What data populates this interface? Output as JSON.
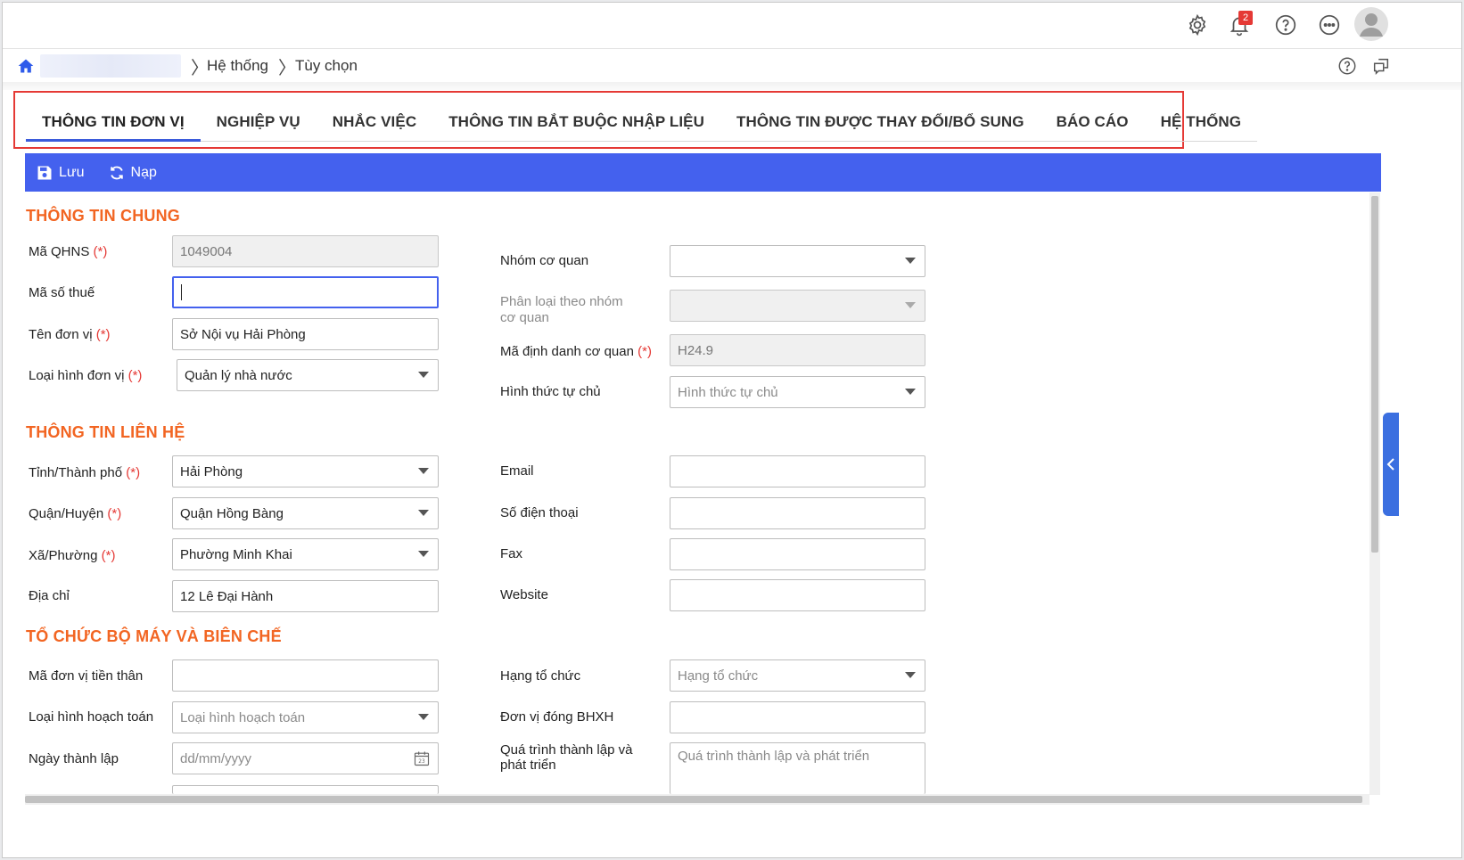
{
  "topbar": {
    "notification_count": "2",
    "icons": [
      "gear-icon",
      "bell-icon",
      "help-icon",
      "more-icon",
      "avatar"
    ]
  },
  "breadcrumb": {
    "items": [
      "Hệ thống",
      "Tùy chọn"
    ]
  },
  "tabs": [
    {
      "label": "THÔNG TIN ĐƠN VỊ",
      "active": true
    },
    {
      "label": "NGHIỆP VỤ"
    },
    {
      "label": "NHẮC VIỆC"
    },
    {
      "label": "THÔNG TIN BẮT BUỘC NHẬP LIỆU"
    },
    {
      "label": "THÔNG TIN ĐƯỢC THAY ĐỔI/BỔ SUNG"
    },
    {
      "label": "BÁO CÁO"
    },
    {
      "label": "HỆ THỐNG"
    }
  ],
  "toolbar": {
    "save_label": "Lưu",
    "reload_label": "Nạp"
  },
  "required_mark": "(*)",
  "sections": {
    "general": {
      "title": "THÔNG TIN CHUNG",
      "ma_qhns": {
        "label": "Mã QHNS",
        "value": "1049004"
      },
      "ma_so_thue": {
        "label": "Mã số thuế",
        "value": ""
      },
      "ten_don_vi": {
        "label": "Tên đơn vị",
        "value": "Sở Nội vụ Hải Phòng"
      },
      "loai_hinh": {
        "label": "Loại hình đơn vị",
        "value": "Quản lý nhà nước"
      },
      "nhom_co_quan": {
        "label": "Nhóm cơ quan",
        "value": ""
      },
      "phan_loai": {
        "label_line1": "Phân loại theo nhóm",
        "label_line2": "cơ quan",
        "value": ""
      },
      "ma_dinh_danh": {
        "label": "Mã định danh cơ quan",
        "value": "H24.9"
      },
      "hinh_thuc_tu_chu": {
        "label": "Hình thức tự chủ",
        "placeholder": "Hình thức tự chủ"
      }
    },
    "contact": {
      "title": "THÔNG TIN LIÊN HỆ",
      "tinh": {
        "label": "Tỉnh/Thành phố",
        "value": "Hải Phòng"
      },
      "quan": {
        "label": "Quận/Huyện",
        "value": "Quận Hồng Bàng"
      },
      "xa": {
        "label": "Xã/Phường",
        "value": "Phường Minh Khai"
      },
      "dia_chi": {
        "label": "Địa chỉ",
        "value": "12 Lê Đại Hành"
      },
      "email": {
        "label": "Email",
        "value": ""
      },
      "phone": {
        "label": "Số điện thoại",
        "value": ""
      },
      "fax": {
        "label": "Fax",
        "value": ""
      },
      "website": {
        "label": "Website",
        "value": ""
      }
    },
    "org": {
      "title": "TỔ CHỨC BỘ MÁY VÀ BIÊN CHẾ",
      "ma_tien_than": {
        "label": "Mã đơn vị tiền thân",
        "value": ""
      },
      "loai_hach_toan": {
        "label": "Loại hình hoạch toán",
        "placeholder": "Loại hình hoạch toán"
      },
      "ngay_thanh_lap": {
        "label": "Ngày thành lập",
        "placeholder": "dd/mm/yyyy"
      },
      "hang_to_chuc": {
        "label": "Hạng tổ chức",
        "placeholder": "Hạng tổ chức"
      },
      "don_vi_bhxh": {
        "label": "Đơn vị đóng BHXH",
        "value": ""
      },
      "qua_trinh": {
        "label_line1": "Quá trình thành lập và",
        "label_line2": "phát triển",
        "placeholder": "Quá trình thành lập và phát triển"
      }
    }
  },
  "colors": {
    "accent": "#4461ee",
    "section_title": "#f26522",
    "required": "#e53935",
    "highlight_frame": "#e53935"
  }
}
